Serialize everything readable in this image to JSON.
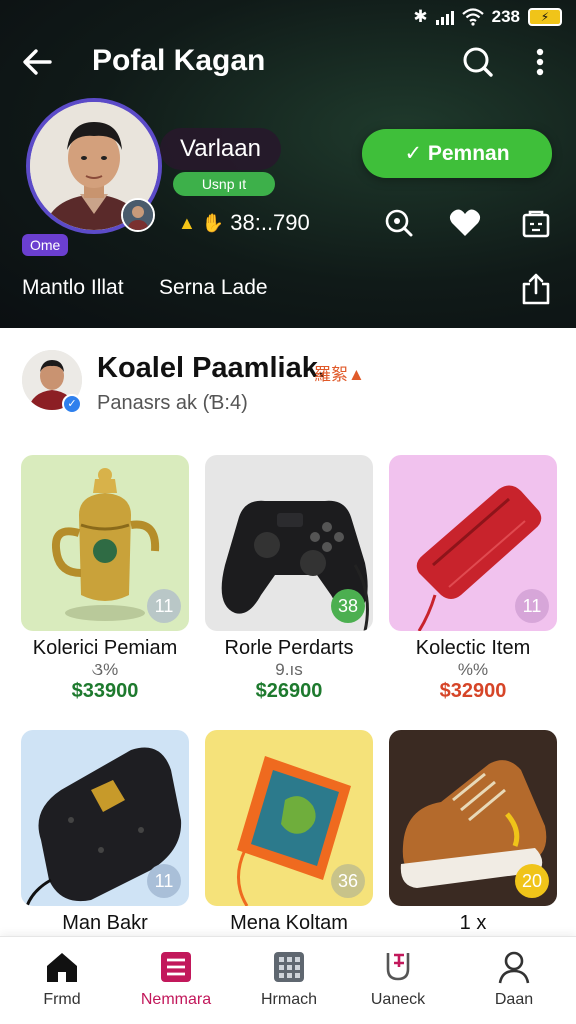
{
  "status_bar": {
    "time": "238",
    "battery_label": "⚡"
  },
  "header": {
    "title": "Pofal Kagan",
    "profile": {
      "name": "Varlaan",
      "upgrade_label": "Usnp ıt",
      "online_label": "Ome",
      "points": "38:..790",
      "primary_action": "✓ Pemnan"
    },
    "tabs": [
      "Mantlo Illat",
      "Serna Lade"
    ]
  },
  "seller": {
    "name": "Koalel Paamliak.",
    "tag": "羅絮▲",
    "subtitle": "Panasrs ak (Ɓ:4)"
  },
  "products": [
    {
      "title": "Kolerici Pemiam",
      "meta": "૩%",
      "price": "$33900",
      "badge": "11",
      "price_color": "#1e7a2e",
      "badge_color": "#b9c7c7",
      "bg": "#d9ebbd",
      "icon": "trophy-icon"
    },
    {
      "title": "Rorle Perdarts",
      "meta": "9.ıs",
      "price": "$26900",
      "badge": "38",
      "price_color": "#1e7a2e",
      "badge_color": "#4caf50",
      "bg": "#e6e6e6",
      "icon": "gamepad-icon"
    },
    {
      "title": "Kolectic Item",
      "meta": "%%",
      "price": "$32900",
      "badge": "11",
      "price_color": "#d64528",
      "badge_color": "#d7a6d9",
      "bg": "#f1c2ee",
      "icon": "wallet-icon"
    },
    {
      "title": "Man Bakr",
      "meta": "",
      "price": "",
      "badge": "11",
      "price_color": "#1e7a2e",
      "badge_color": "#a9bfd8",
      "bg": "#cfe3f5",
      "icon": "pouch-icon"
    },
    {
      "title": "Mena Koltam",
      "meta": "",
      "price": "",
      "badge": "36",
      "price_color": "#1e7a2e",
      "badge_color": "#c8c38a",
      "bg": "#f5e27a",
      "icon": "tablet-icon"
    },
    {
      "title": "1 x",
      "meta": "",
      "price": "",
      "badge": "20",
      "price_color": "#1e7a2e",
      "badge_color": "#f0c419",
      "bg": "#3a2a22",
      "icon": "sneaker-icon"
    }
  ],
  "bottom_nav": [
    {
      "label": "Frmd",
      "icon": "home-icon"
    },
    {
      "label": "Nemmara",
      "icon": "list-icon",
      "active": true
    },
    {
      "label": "Hrmach",
      "icon": "keypad-icon"
    },
    {
      "label": "Uaneck",
      "icon": "scale-icon"
    },
    {
      "label": "Daan",
      "icon": "person-icon"
    }
  ],
  "colors": {
    "accent_green": "#3fbf3a",
    "active_nav": "#c2185b",
    "header_bg": "#101a18"
  }
}
